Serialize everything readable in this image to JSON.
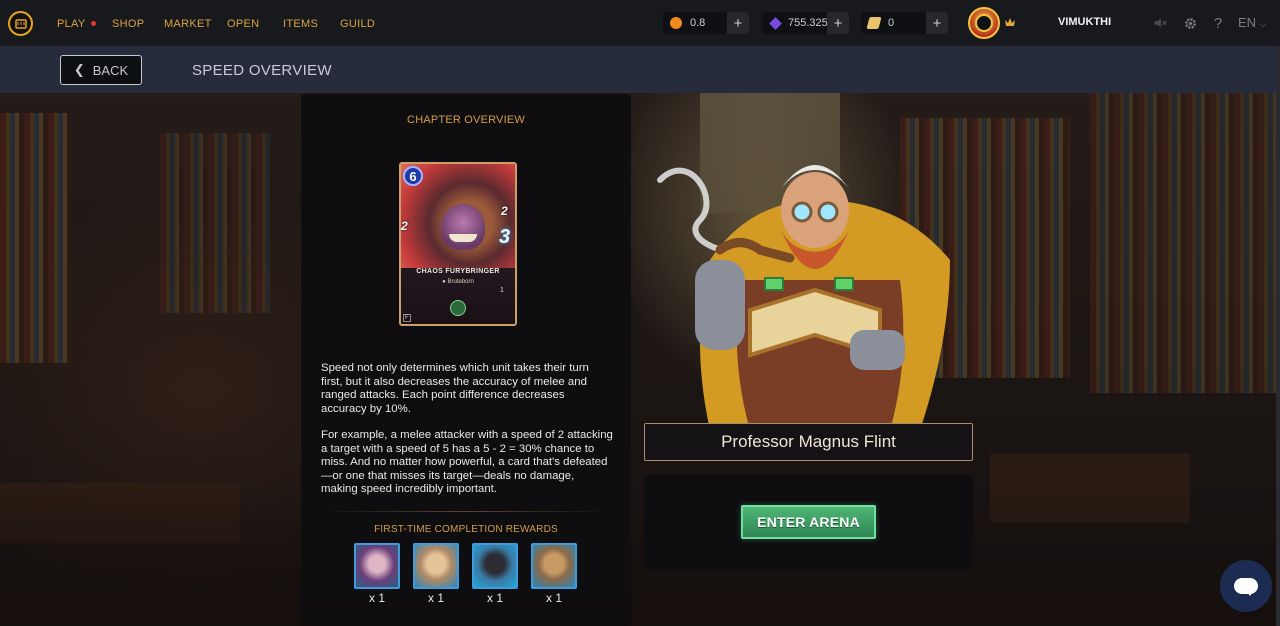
{
  "nav": {
    "items": [
      {
        "label": "PLAY",
        "has_dot": true
      },
      {
        "label": "SHOP"
      },
      {
        "label": "MARKET"
      },
      {
        "label": "OPEN"
      },
      {
        "label": "ITEMS"
      },
      {
        "label": "GUILD"
      }
    ]
  },
  "resources": {
    "credits": {
      "value": "0.8",
      "icon": "orange-coin-icon"
    },
    "gems": {
      "value": "755.325",
      "icon": "purple-crystal-icon"
    },
    "vouchers": {
      "value": "0",
      "icon": "voucher-icon"
    }
  },
  "user": {
    "name": "VIMUKTHI"
  },
  "language": "EN",
  "header": {
    "back_label": "BACK",
    "title": "SPEED OVERVIEW"
  },
  "chapter": {
    "heading": "CHAPTER OVERVIEW",
    "card": {
      "name": "CHAOS FURYBRINGER",
      "type": "Bruteborn",
      "mana": "6",
      "attack": "2",
      "speed": "3",
      "health": "2",
      "level": "1"
    },
    "paragraphs": [
      "Speed not only determines which unit takes their turn first, but it also decreases the accuracy of melee and ranged attacks. Each point difference decreases accuracy by 10%.",
      "For example, a melee attacker with a speed of 2 attacking a target with a speed of 5 has a 5 - 2 = 30% chance to miss. And no matter how powerful, a card that's defeated—or one that misses its target—deals no damage, making speed incredibly important."
    ],
    "rewards_heading": "FIRST-TIME COMPLETION REWARDS",
    "rewards": [
      {
        "qty": "x 1"
      },
      {
        "qty": "x 1"
      },
      {
        "qty": "x 1"
      },
      {
        "qty": "x 1"
      }
    ]
  },
  "professor": {
    "name": "Professor Magnus Flint"
  },
  "arena": {
    "button_label": "ENTER ARENA"
  },
  "colors": {
    "accent_gold": "#d39f4c",
    "arena_green": "#2f8652",
    "header_bg": "#272c3d"
  }
}
